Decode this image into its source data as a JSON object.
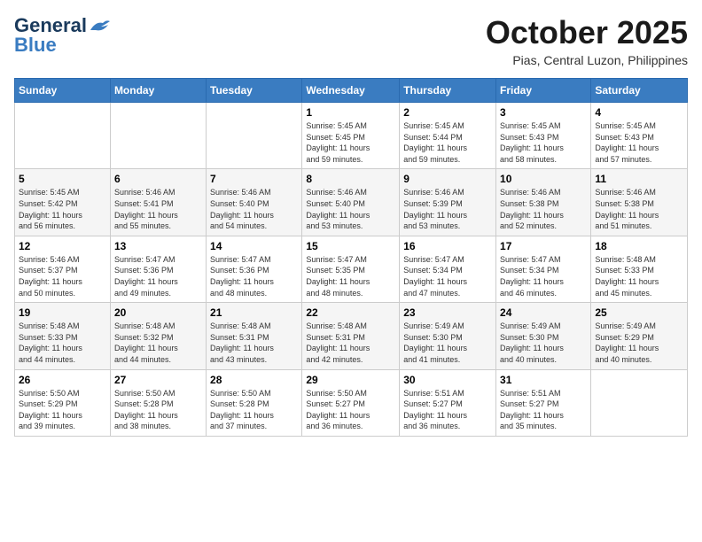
{
  "logo": {
    "general": "General",
    "blue": "Blue"
  },
  "header": {
    "title": "October 2025",
    "subtitle": "Pias, Central Luzon, Philippines"
  },
  "weekdays": [
    "Sunday",
    "Monday",
    "Tuesday",
    "Wednesday",
    "Thursday",
    "Friday",
    "Saturday"
  ],
  "weeks": [
    [
      {
        "day": "",
        "info": ""
      },
      {
        "day": "",
        "info": ""
      },
      {
        "day": "",
        "info": ""
      },
      {
        "day": "1",
        "info": "Sunrise: 5:45 AM\nSunset: 5:45 PM\nDaylight: 11 hours\nand 59 minutes."
      },
      {
        "day": "2",
        "info": "Sunrise: 5:45 AM\nSunset: 5:44 PM\nDaylight: 11 hours\nand 59 minutes."
      },
      {
        "day": "3",
        "info": "Sunrise: 5:45 AM\nSunset: 5:43 PM\nDaylight: 11 hours\nand 58 minutes."
      },
      {
        "day": "4",
        "info": "Sunrise: 5:45 AM\nSunset: 5:43 PM\nDaylight: 11 hours\nand 57 minutes."
      }
    ],
    [
      {
        "day": "5",
        "info": "Sunrise: 5:45 AM\nSunset: 5:42 PM\nDaylight: 11 hours\nand 56 minutes."
      },
      {
        "day": "6",
        "info": "Sunrise: 5:46 AM\nSunset: 5:41 PM\nDaylight: 11 hours\nand 55 minutes."
      },
      {
        "day": "7",
        "info": "Sunrise: 5:46 AM\nSunset: 5:40 PM\nDaylight: 11 hours\nand 54 minutes."
      },
      {
        "day": "8",
        "info": "Sunrise: 5:46 AM\nSunset: 5:40 PM\nDaylight: 11 hours\nand 53 minutes."
      },
      {
        "day": "9",
        "info": "Sunrise: 5:46 AM\nSunset: 5:39 PM\nDaylight: 11 hours\nand 53 minutes."
      },
      {
        "day": "10",
        "info": "Sunrise: 5:46 AM\nSunset: 5:38 PM\nDaylight: 11 hours\nand 52 minutes."
      },
      {
        "day": "11",
        "info": "Sunrise: 5:46 AM\nSunset: 5:38 PM\nDaylight: 11 hours\nand 51 minutes."
      }
    ],
    [
      {
        "day": "12",
        "info": "Sunrise: 5:46 AM\nSunset: 5:37 PM\nDaylight: 11 hours\nand 50 minutes."
      },
      {
        "day": "13",
        "info": "Sunrise: 5:47 AM\nSunset: 5:36 PM\nDaylight: 11 hours\nand 49 minutes."
      },
      {
        "day": "14",
        "info": "Sunrise: 5:47 AM\nSunset: 5:36 PM\nDaylight: 11 hours\nand 48 minutes."
      },
      {
        "day": "15",
        "info": "Sunrise: 5:47 AM\nSunset: 5:35 PM\nDaylight: 11 hours\nand 48 minutes."
      },
      {
        "day": "16",
        "info": "Sunrise: 5:47 AM\nSunset: 5:34 PM\nDaylight: 11 hours\nand 47 minutes."
      },
      {
        "day": "17",
        "info": "Sunrise: 5:47 AM\nSunset: 5:34 PM\nDaylight: 11 hours\nand 46 minutes."
      },
      {
        "day": "18",
        "info": "Sunrise: 5:48 AM\nSunset: 5:33 PM\nDaylight: 11 hours\nand 45 minutes."
      }
    ],
    [
      {
        "day": "19",
        "info": "Sunrise: 5:48 AM\nSunset: 5:33 PM\nDaylight: 11 hours\nand 44 minutes."
      },
      {
        "day": "20",
        "info": "Sunrise: 5:48 AM\nSunset: 5:32 PM\nDaylight: 11 hours\nand 44 minutes."
      },
      {
        "day": "21",
        "info": "Sunrise: 5:48 AM\nSunset: 5:31 PM\nDaylight: 11 hours\nand 43 minutes."
      },
      {
        "day": "22",
        "info": "Sunrise: 5:48 AM\nSunset: 5:31 PM\nDaylight: 11 hours\nand 42 minutes."
      },
      {
        "day": "23",
        "info": "Sunrise: 5:49 AM\nSunset: 5:30 PM\nDaylight: 11 hours\nand 41 minutes."
      },
      {
        "day": "24",
        "info": "Sunrise: 5:49 AM\nSunset: 5:30 PM\nDaylight: 11 hours\nand 40 minutes."
      },
      {
        "day": "25",
        "info": "Sunrise: 5:49 AM\nSunset: 5:29 PM\nDaylight: 11 hours\nand 40 minutes."
      }
    ],
    [
      {
        "day": "26",
        "info": "Sunrise: 5:50 AM\nSunset: 5:29 PM\nDaylight: 11 hours\nand 39 minutes."
      },
      {
        "day": "27",
        "info": "Sunrise: 5:50 AM\nSunset: 5:28 PM\nDaylight: 11 hours\nand 38 minutes."
      },
      {
        "day": "28",
        "info": "Sunrise: 5:50 AM\nSunset: 5:28 PM\nDaylight: 11 hours\nand 37 minutes."
      },
      {
        "day": "29",
        "info": "Sunrise: 5:50 AM\nSunset: 5:27 PM\nDaylight: 11 hours\nand 36 minutes."
      },
      {
        "day": "30",
        "info": "Sunrise: 5:51 AM\nSunset: 5:27 PM\nDaylight: 11 hours\nand 36 minutes."
      },
      {
        "day": "31",
        "info": "Sunrise: 5:51 AM\nSunset: 5:27 PM\nDaylight: 11 hours\nand 35 minutes."
      },
      {
        "day": "",
        "info": ""
      }
    ]
  ]
}
